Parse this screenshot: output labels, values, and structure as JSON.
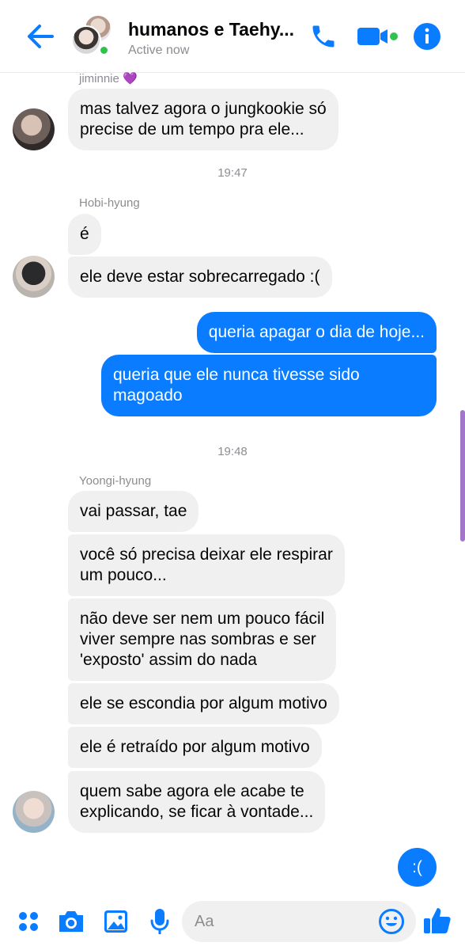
{
  "header": {
    "title": "humanos e Taehy...",
    "status": "Active now",
    "icons": [
      "back-arrow-icon",
      "phone-icon",
      "video-camera-icon",
      "info-icon"
    ],
    "accent_color": "#0a7cff"
  },
  "messages": [
    {
      "sender": "jiminnie 💜",
      "text": "mas talvez agora o jungkookie só\nprecise de um tempo pra ele..."
    },
    {
      "time": "19:47"
    },
    {
      "sender": "Hobi-hyung",
      "text": "é"
    },
    {
      "text": "ele deve estar sobrecarregado :("
    },
    {
      "outgoing": true,
      "text": "queria apagar o dia de hoje..."
    },
    {
      "outgoing": true,
      "text": "queria que ele nunca tivesse sido\nmagoado"
    },
    {
      "time": "19:48"
    },
    {
      "sender": "Yoongi-hyung",
      "text": "vai passar, tae"
    },
    {
      "text": "você só precisa deixar ele respirar\num pouco..."
    },
    {
      "text": "não deve ser nem um pouco fácil\nviver sempre nas sombras e ser\n'exposto' assim do nada"
    },
    {
      "text": "ele se escondia por algum motivo"
    },
    {
      "text": "ele é retraído por algum motivo"
    },
    {
      "text": "quem sabe agora ele acabe te\nexplicando, se ficar à vontade..."
    },
    {
      "outgoing": true,
      "text": ":("
    }
  ],
  "composer": {
    "placeholder": "Aa",
    "icons": [
      "menu-dots-icon",
      "camera-icon",
      "gallery-icon",
      "microphone-icon",
      "emoji-icon",
      "thumbs-up-icon"
    ]
  }
}
